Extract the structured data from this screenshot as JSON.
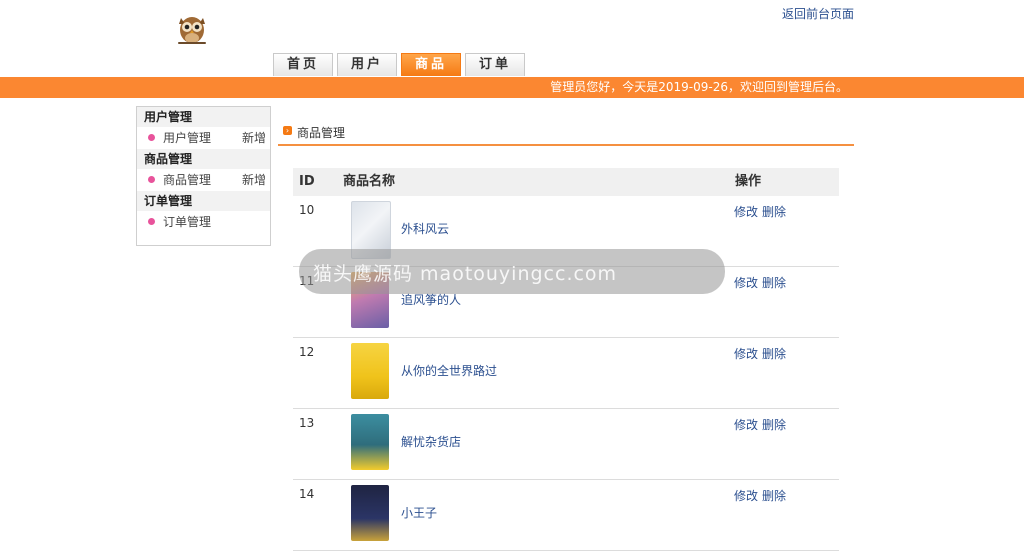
{
  "header": {
    "back_link": "返回前台页面",
    "nav_tabs": [
      {
        "label": "首页",
        "active": false
      },
      {
        "label": "用户",
        "active": false
      },
      {
        "label": "商品",
        "active": true
      },
      {
        "label": "订单",
        "active": false
      }
    ],
    "greeting": "管理员您好，今天是2019-09-26，欢迎回到管理后台。"
  },
  "sidebar": {
    "sections": [
      {
        "title": "用户管理",
        "item": "用户管理",
        "add": "新增"
      },
      {
        "title": "商品管理",
        "item": "商品管理",
        "add": "新增"
      },
      {
        "title": "订单管理",
        "item": "订单管理"
      }
    ]
  },
  "main": {
    "breadcrumb": "商品管理",
    "columns": {
      "id": "ID",
      "name": "商品名称",
      "op": "操作"
    },
    "rows": [
      {
        "id": "10",
        "name": "外科风云",
        "edit": "修改",
        "del": "删除"
      },
      {
        "id": "11",
        "name": "追风筝的人",
        "edit": "修改",
        "del": "删除"
      },
      {
        "id": "12",
        "name": "从你的全世界路过",
        "edit": "修改",
        "del": "删除"
      },
      {
        "id": "13",
        "name": "解忧杂货店",
        "edit": "修改",
        "del": "删除"
      },
      {
        "id": "14",
        "name": "小王子",
        "edit": "修改",
        "del": "删除"
      }
    ]
  },
  "watermark": "猫头鹰源码 maotouyingcc.com",
  "colors": {
    "accent": "#fb8731",
    "link": "#2b4f8f",
    "bullet": "#e8539b"
  },
  "icons": {
    "logo": "owl-logo-icon",
    "bullet": "pink-dot-icon",
    "breadcrumb": "orange-square-icon"
  }
}
